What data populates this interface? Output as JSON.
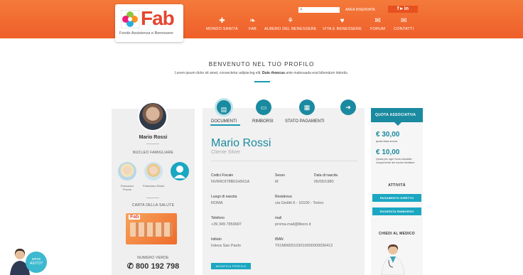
{
  "header": {
    "logo_text": "Fab",
    "logo_subtitle": "Fondo Assistenza e Benessere",
    "area_link": "AREA RISERVATA",
    "social": "f  ▸  in",
    "nav": [
      {
        "label": "MONDO SANITÀ",
        "icon": "cross-icon",
        "glyph": "✚"
      },
      {
        "label": "FAB",
        "icon": "leaf-icon",
        "glyph": "❧"
      },
      {
        "label": "ALBERO DEL BENESSERE",
        "icon": "tree-icon",
        "glyph": "⚘"
      },
      {
        "label": "VITA E BENESSERE",
        "icon": "heart-icon",
        "glyph": "♥"
      },
      {
        "label": "FORUM",
        "icon": "chat-icon",
        "glyph": "✉"
      },
      {
        "label": "CONTATTI",
        "icon": "mail-icon",
        "glyph": "✉"
      }
    ]
  },
  "welcome": {
    "title": "BENVENUTO NEL TUO PROFILO",
    "subtitle_start": "Lorem ipsum dolor sit amet, consectetur adipiscing elit. ",
    "subtitle_bold": "Duis rhoncus",
    "subtitle_end": " ante malesuada erat bibendum lobortis."
  },
  "left": {
    "name": "Mario Rossi",
    "family_label": "NUCLEO FAMIGLIARE",
    "family": [
      {
        "name": "Francesco Puccio"
      },
      {
        "name": "Francesco Rossi"
      },
      {
        "name": ""
      }
    ],
    "card_label": "CARTA DELLA SALUTE",
    "card_logo": "Fab",
    "phone_label": "NUMERO VERDE",
    "phone": "✆ 800 192 798"
  },
  "tabs": [
    {
      "label": "DOCUMENTI",
      "icon": "folder-icon",
      "glyph": "▤"
    },
    {
      "label": "RIMBORSI",
      "icon": "card-icon",
      "glyph": "▭"
    },
    {
      "label": "STATO PAGAMENTI",
      "icon": "calendar-icon",
      "glyph": "▦"
    },
    {
      "label": "",
      "icon": "arrow-right-icon",
      "glyph": "➜"
    }
  ],
  "profile": {
    "name": "Mario Rossi",
    "plan": "Cliente Silver",
    "fields": [
      {
        "label": "Codici Fiscale",
        "value": "NVRROI78B01H501A"
      },
      {
        "label": "Sesso",
        "value": "M"
      },
      {
        "label": "Data di nascita",
        "value": "05/05/1980"
      },
      {
        "label": "Luogo di nascita",
        "value": "ROMA"
      },
      {
        "label": "Residenza",
        "value": "via Giolitti 6 - 10100 - Torino"
      },
      {
        "label": "Telefono",
        "value": "+39 349 7859687"
      },
      {
        "label": "mail",
        "value": "proma.mail@libero.it"
      },
      {
        "label": "Istituto",
        "value": "Intesa San Paolo"
      },
      {
        "label": "IBAN",
        "value": "T61M0605103010000000036412"
      }
    ],
    "edit_button": "MODIFICA PROFILO"
  },
  "right": {
    "header": "QUOTA ASSOCIATIVA",
    "amount1": "€ 30,00",
    "note1": "quota fissa annua",
    "amount2": "€ 10,00",
    "note2": "Quota per ogni Socio Assistito componente del nucleo familiare",
    "activity": "ATTIVITÀ",
    "btn1": "PAGAMENTO DIRETTO",
    "btn2": "RICHIESTA RIMBORSO",
    "ask_doctor": "CHIEDI AL MEDICO"
  },
  "help": {
    "line1": "serve",
    "line2": "AIUTO?"
  },
  "colors": {
    "brand_orange": "#ef5f2a",
    "teal": "#1a8aa0",
    "teal_light": "#1aa7c2"
  }
}
